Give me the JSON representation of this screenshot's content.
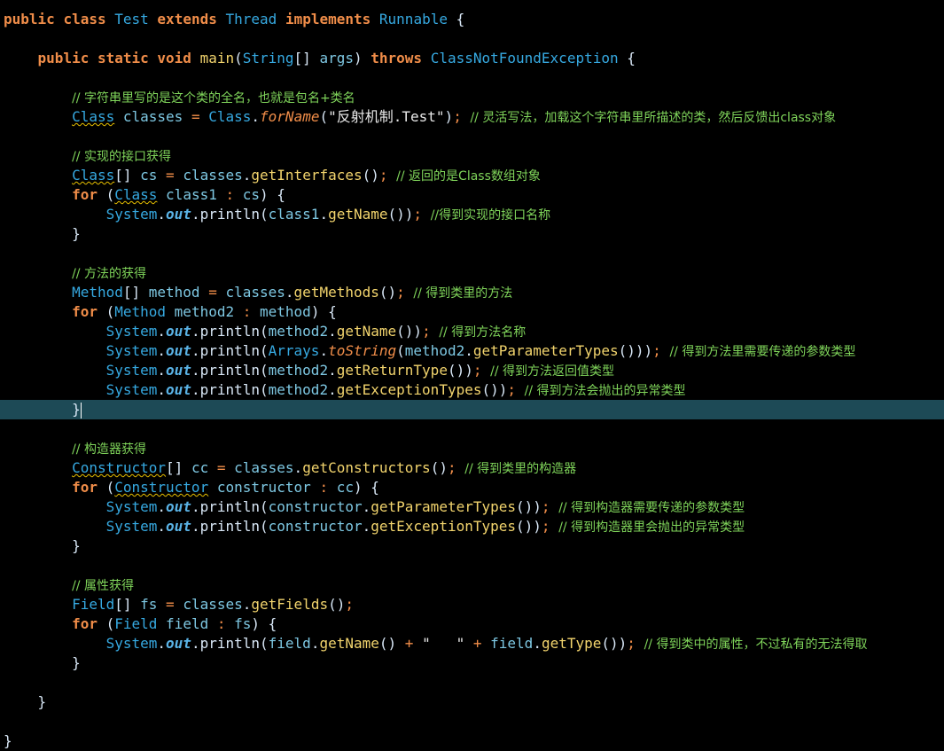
{
  "colors": {
    "background": "#000000",
    "keyword": "#f08d49",
    "type": "#36a9e1",
    "method": "#f2d46d",
    "comment": "#7fd45a",
    "current_line": "#1d4a56"
  },
  "editor": {
    "current_line_index": 20,
    "lines": [
      [
        [
          "kw",
          "public"
        ],
        [
          "pl",
          " "
        ],
        [
          "kw",
          "class"
        ],
        [
          "pl",
          " "
        ],
        [
          "type",
          "Test"
        ],
        [
          "pl",
          " "
        ],
        [
          "kw",
          "extends"
        ],
        [
          "pl",
          " "
        ],
        [
          "type",
          "Thread"
        ],
        [
          "pl",
          " "
        ],
        [
          "kw",
          "implements"
        ],
        [
          "pl",
          " "
        ],
        [
          "type",
          "Runnable"
        ],
        [
          "pl",
          " {"
        ]
      ],
      [],
      [
        [
          "pl",
          "    "
        ],
        [
          "kw",
          "public"
        ],
        [
          "pl",
          " "
        ],
        [
          "kw",
          "static"
        ],
        [
          "pl",
          " "
        ],
        [
          "kw",
          "void"
        ],
        [
          "pl",
          " "
        ],
        [
          "fn",
          "main"
        ],
        [
          "pl",
          "("
        ],
        [
          "type",
          "String"
        ],
        [
          "pl",
          "[] "
        ],
        [
          "var",
          "args"
        ],
        [
          "pl",
          ") "
        ],
        [
          "kw",
          "throws"
        ],
        [
          "pl",
          " "
        ],
        [
          "type",
          "ClassNotFoundException"
        ],
        [
          "pl",
          " {"
        ]
      ],
      [],
      [
        [
          "pl",
          "        "
        ],
        [
          "cm",
          "// 字符串里写的是这个类的全名，也就是包名+类名"
        ]
      ],
      [
        [
          "pl",
          "        "
        ],
        [
          "cls",
          "Class"
        ],
        [
          "pl",
          " "
        ],
        [
          "var",
          "classes"
        ],
        [
          "op",
          " = "
        ],
        [
          "type",
          "Class"
        ],
        [
          "pl",
          "."
        ],
        [
          "stm",
          "forName"
        ],
        [
          "pl",
          "("
        ],
        [
          "str",
          "\"反射机制.Test\""
        ],
        [
          "pl",
          ")"
        ],
        [
          "op",
          ";"
        ],
        [
          "pl",
          " "
        ],
        [
          "cm",
          "// 灵活写法，加载这个字符串里所描述的类，然后反馈出class对象"
        ]
      ],
      [],
      [
        [
          "pl",
          "        "
        ],
        [
          "cm",
          "// 实现的接口获得"
        ]
      ],
      [
        [
          "pl",
          "        "
        ],
        [
          "cls",
          "Class"
        ],
        [
          "pl",
          "[] "
        ],
        [
          "var",
          "cs"
        ],
        [
          "op",
          " = "
        ],
        [
          "var",
          "classes"
        ],
        [
          "pl",
          "."
        ],
        [
          "fn",
          "getInterfaces"
        ],
        [
          "pl",
          "()"
        ],
        [
          "op",
          ";"
        ],
        [
          "pl",
          " "
        ],
        [
          "cm",
          "// 返回的是Class数组对象"
        ]
      ],
      [
        [
          "pl",
          "        "
        ],
        [
          "kw",
          "for"
        ],
        [
          "pl",
          " ("
        ],
        [
          "cls",
          "Class"
        ],
        [
          "pl",
          " "
        ],
        [
          "var",
          "class1"
        ],
        [
          "op",
          " : "
        ],
        [
          "var",
          "cs"
        ],
        [
          "pl",
          ") {"
        ]
      ],
      [
        [
          "pl",
          "            "
        ],
        [
          "type",
          "System"
        ],
        [
          "pl",
          "."
        ],
        [
          "st",
          "out"
        ],
        [
          "pl",
          "."
        ],
        [
          "pl",
          "println("
        ],
        [
          "var",
          "class1"
        ],
        [
          "pl",
          "."
        ],
        [
          "fn",
          "getName"
        ],
        [
          "pl",
          "())"
        ],
        [
          "op",
          ";"
        ],
        [
          "pl",
          " "
        ],
        [
          "cm",
          "//得到实现的接口名称"
        ]
      ],
      [
        [
          "pl",
          "        }"
        ]
      ],
      [],
      [
        [
          "pl",
          "        "
        ],
        [
          "cm",
          "// 方法的获得"
        ]
      ],
      [
        [
          "pl",
          "        "
        ],
        [
          "type",
          "Method"
        ],
        [
          "pl",
          "[] "
        ],
        [
          "var",
          "method"
        ],
        [
          "op",
          " = "
        ],
        [
          "var",
          "classes"
        ],
        [
          "pl",
          "."
        ],
        [
          "fn",
          "getMethods"
        ],
        [
          "pl",
          "()"
        ],
        [
          "op",
          ";"
        ],
        [
          "pl",
          " "
        ],
        [
          "cm",
          "// 得到类里的方法"
        ]
      ],
      [
        [
          "pl",
          "        "
        ],
        [
          "kw",
          "for"
        ],
        [
          "pl",
          " ("
        ],
        [
          "type",
          "Method"
        ],
        [
          "pl",
          " "
        ],
        [
          "var",
          "method2"
        ],
        [
          "op",
          " : "
        ],
        [
          "var",
          "method"
        ],
        [
          "pl",
          ") {"
        ]
      ],
      [
        [
          "pl",
          "            "
        ],
        [
          "type",
          "System"
        ],
        [
          "pl",
          "."
        ],
        [
          "st",
          "out"
        ],
        [
          "pl",
          "."
        ],
        [
          "pl",
          "println("
        ],
        [
          "var",
          "method2"
        ],
        [
          "pl",
          "."
        ],
        [
          "fn",
          "getName"
        ],
        [
          "pl",
          "())"
        ],
        [
          "op",
          ";"
        ],
        [
          "pl",
          " "
        ],
        [
          "cm",
          "// 得到方法名称"
        ]
      ],
      [
        [
          "pl",
          "            "
        ],
        [
          "type",
          "System"
        ],
        [
          "pl",
          "."
        ],
        [
          "st",
          "out"
        ],
        [
          "pl",
          "."
        ],
        [
          "pl",
          "println("
        ],
        [
          "type",
          "Arrays"
        ],
        [
          "pl",
          "."
        ],
        [
          "stm",
          "toString"
        ],
        [
          "pl",
          "("
        ],
        [
          "var",
          "method2"
        ],
        [
          "pl",
          "."
        ],
        [
          "fn",
          "getParameterTypes"
        ],
        [
          "pl",
          "()))"
        ],
        [
          "op",
          ";"
        ],
        [
          "pl",
          " "
        ],
        [
          "cm",
          "// 得到方法里需要传递的参数类型"
        ]
      ],
      [
        [
          "pl",
          "            "
        ],
        [
          "type",
          "System"
        ],
        [
          "pl",
          "."
        ],
        [
          "st",
          "out"
        ],
        [
          "pl",
          "."
        ],
        [
          "pl",
          "println("
        ],
        [
          "var",
          "method2"
        ],
        [
          "pl",
          "."
        ],
        [
          "fn",
          "getReturnType"
        ],
        [
          "pl",
          "())"
        ],
        [
          "op",
          ";"
        ],
        [
          "pl",
          " "
        ],
        [
          "cm",
          "// 得到方法返回值类型"
        ]
      ],
      [
        [
          "pl",
          "            "
        ],
        [
          "type",
          "System"
        ],
        [
          "pl",
          "."
        ],
        [
          "st",
          "out"
        ],
        [
          "pl",
          "."
        ],
        [
          "pl",
          "println("
        ],
        [
          "var",
          "method2"
        ],
        [
          "pl",
          "."
        ],
        [
          "fn",
          "getExceptionTypes"
        ],
        [
          "pl",
          "())"
        ],
        [
          "op",
          ";"
        ],
        [
          "pl",
          " "
        ],
        [
          "cm",
          "// 得到方法会抛出的异常类型"
        ]
      ],
      [
        [
          "pl",
          "        }"
        ]
      ],
      [],
      [
        [
          "pl",
          "        "
        ],
        [
          "cm",
          "// 构造器获得"
        ]
      ],
      [
        [
          "pl",
          "        "
        ],
        [
          "cls",
          "Constructor"
        ],
        [
          "pl",
          "[] "
        ],
        [
          "var",
          "cc"
        ],
        [
          "op",
          " = "
        ],
        [
          "var",
          "classes"
        ],
        [
          "pl",
          "."
        ],
        [
          "fn",
          "getConstructors"
        ],
        [
          "pl",
          "()"
        ],
        [
          "op",
          ";"
        ],
        [
          "pl",
          " "
        ],
        [
          "cm",
          "// 得到类里的构造器"
        ]
      ],
      [
        [
          "pl",
          "        "
        ],
        [
          "kw",
          "for"
        ],
        [
          "pl",
          " ("
        ],
        [
          "cls",
          "Constructor"
        ],
        [
          "pl",
          " "
        ],
        [
          "var",
          "constructor"
        ],
        [
          "op",
          " : "
        ],
        [
          "var",
          "cc"
        ],
        [
          "pl",
          ") {"
        ]
      ],
      [
        [
          "pl",
          "            "
        ],
        [
          "type",
          "System"
        ],
        [
          "pl",
          "."
        ],
        [
          "st",
          "out"
        ],
        [
          "pl",
          "."
        ],
        [
          "pl",
          "println("
        ],
        [
          "var",
          "constructor"
        ],
        [
          "pl",
          "."
        ],
        [
          "fn",
          "getParameterTypes"
        ],
        [
          "pl",
          "())"
        ],
        [
          "op",
          ";"
        ],
        [
          "pl",
          " "
        ],
        [
          "cm",
          "// 得到构造器需要传递的参数类型"
        ]
      ],
      [
        [
          "pl",
          "            "
        ],
        [
          "type",
          "System"
        ],
        [
          "pl",
          "."
        ],
        [
          "st",
          "out"
        ],
        [
          "pl",
          "."
        ],
        [
          "pl",
          "println("
        ],
        [
          "var",
          "constructor"
        ],
        [
          "pl",
          "."
        ],
        [
          "fn",
          "getExceptionTypes"
        ],
        [
          "pl",
          "())"
        ],
        [
          "op",
          ";"
        ],
        [
          "pl",
          " "
        ],
        [
          "cm",
          "// 得到构造器里会抛出的异常类型"
        ]
      ],
      [
        [
          "pl",
          "        }"
        ]
      ],
      [],
      [
        [
          "pl",
          "        "
        ],
        [
          "cm",
          "// 属性获得"
        ]
      ],
      [
        [
          "pl",
          "        "
        ],
        [
          "type",
          "Field"
        ],
        [
          "pl",
          "[] "
        ],
        [
          "var",
          "fs"
        ],
        [
          "op",
          " = "
        ],
        [
          "var",
          "classes"
        ],
        [
          "pl",
          "."
        ],
        [
          "fn",
          "getFields"
        ],
        [
          "pl",
          "()"
        ],
        [
          "op",
          ";"
        ]
      ],
      [
        [
          "pl",
          "        "
        ],
        [
          "kw",
          "for"
        ],
        [
          "pl",
          " ("
        ],
        [
          "type",
          "Field"
        ],
        [
          "pl",
          " "
        ],
        [
          "var",
          "field"
        ],
        [
          "op",
          " : "
        ],
        [
          "var",
          "fs"
        ],
        [
          "pl",
          ") {"
        ]
      ],
      [
        [
          "pl",
          "            "
        ],
        [
          "type",
          "System"
        ],
        [
          "pl",
          "."
        ],
        [
          "st",
          "out"
        ],
        [
          "pl",
          "."
        ],
        [
          "pl",
          "println("
        ],
        [
          "var",
          "field"
        ],
        [
          "pl",
          "."
        ],
        [
          "fn",
          "getName"
        ],
        [
          "pl",
          "()"
        ],
        [
          "op",
          " + "
        ],
        [
          "str",
          "\"   \""
        ],
        [
          "op",
          " + "
        ],
        [
          "var",
          "field"
        ],
        [
          "pl",
          "."
        ],
        [
          "fn",
          "getType"
        ],
        [
          "pl",
          "())"
        ],
        [
          "op",
          ";"
        ],
        [
          "pl",
          " "
        ],
        [
          "cm",
          "// 得到类中的属性，不过私有的无法得取"
        ]
      ],
      [
        [
          "pl",
          "        }"
        ]
      ],
      [],
      [
        [
          "pl",
          "    }"
        ]
      ],
      [],
      [
        [
          "pl",
          "}"
        ]
      ]
    ]
  }
}
